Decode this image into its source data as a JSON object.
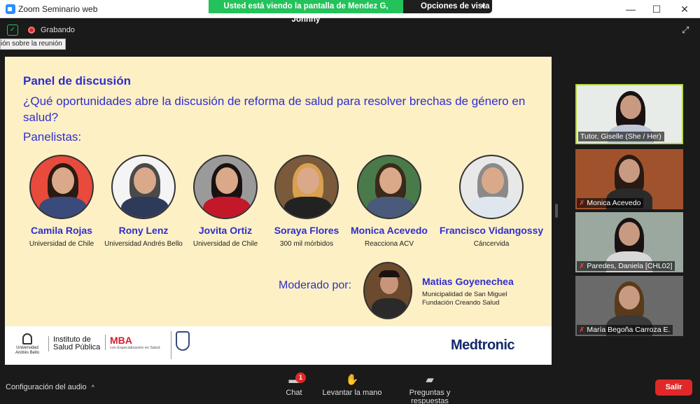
{
  "window": {
    "title": "Zoom Seminario web",
    "banner": "Usted está viendo la pantalla de Mendez G, Johnny",
    "view_options": "Opciones de vista",
    "controls": [
      "—",
      "☐",
      "✕"
    ]
  },
  "meeting": {
    "recording_label": "Grabando",
    "tooltip": "ión sobre la reunión"
  },
  "slide": {
    "title": "Panel de discusión",
    "question": "¿Qué oportunidades abre la discusión de reforma de salud para resolver brechas de género en salud?",
    "panelists_label": "Panelistas:",
    "panelists": [
      {
        "name": "Camila Rojas",
        "org": "Universidad de Chile",
        "bg": "#e84a3c",
        "hair": "#2a1a12",
        "body": "#3a4a7a"
      },
      {
        "name": "Rony Lenz",
        "org": "Universidad Andrés Bello",
        "bg": "#f4f4f4",
        "hair": "#4a4a4a",
        "body": "#2e3a5a"
      },
      {
        "name": "Jovita Ortiz",
        "org": "Universidad de Chile",
        "bg": "#9a9a9a",
        "hair": "#1a1210",
        "body": "#c2182a"
      },
      {
        "name": "Soraya Flores",
        "org": "300 mil mórbidos",
        "bg": "#7a5a3a",
        "hair": "#d9a050",
        "body": "#222222"
      },
      {
        "name": "Monica Acevedo",
        "org": "Reacciona ACV",
        "bg": "#4a7a4a",
        "hair": "#3a2a1a",
        "body": "#4a5a7a"
      },
      {
        "name": "Francisco Vidangossy",
        "org": "Cáncervida",
        "bg": "#e8e8e8",
        "hair": "#8a8a8a",
        "body": "#e0e6ee"
      }
    ],
    "moderator_label": "Moderado por:",
    "moderator": {
      "name": "Matias Goyenechea",
      "org_line1": "Municipalidad de San Miguel",
      "org_line2": "Fundación Creando Salud"
    },
    "footer": {
      "unab_line1": "Universidad",
      "unab_line2": "Andrés Bello",
      "isp_line1": "Instituto de",
      "isp_line2": "Salud Pública",
      "mba": "MBA",
      "mba_sub": "con Especialización en Salud",
      "medtronic": "Medtronic"
    }
  },
  "participants": [
    {
      "name": "Tutor, Giselle (She / Her)",
      "muted": false,
      "active": true,
      "bg": "#e8ece8",
      "hair": "#1a1212",
      "body": "#c0c8d8"
    },
    {
      "name": "Monica Acevedo",
      "muted": true,
      "active": false,
      "bg": "#a0522d",
      "hair": "#2a1a12",
      "body": "#2a2a2a"
    },
    {
      "name": "Paredes, Daniela [CHL02]",
      "muted": true,
      "active": false,
      "bg": "#9aa8a0",
      "hair": "#1a1212",
      "body": "#d8d8d8"
    },
    {
      "name": "María Begoña Carroza E.",
      "muted": true,
      "active": false,
      "bg": "#6a6a6a",
      "hair": "#5a3a1a",
      "body": "#3a3a3a"
    }
  ],
  "toolbar": {
    "audio_settings": "Configuración del audio",
    "chat": "Chat",
    "chat_badge": "1",
    "raise_hand": "Levantar la mano",
    "qa": "Preguntas y respuestas",
    "leave": "Salir"
  }
}
